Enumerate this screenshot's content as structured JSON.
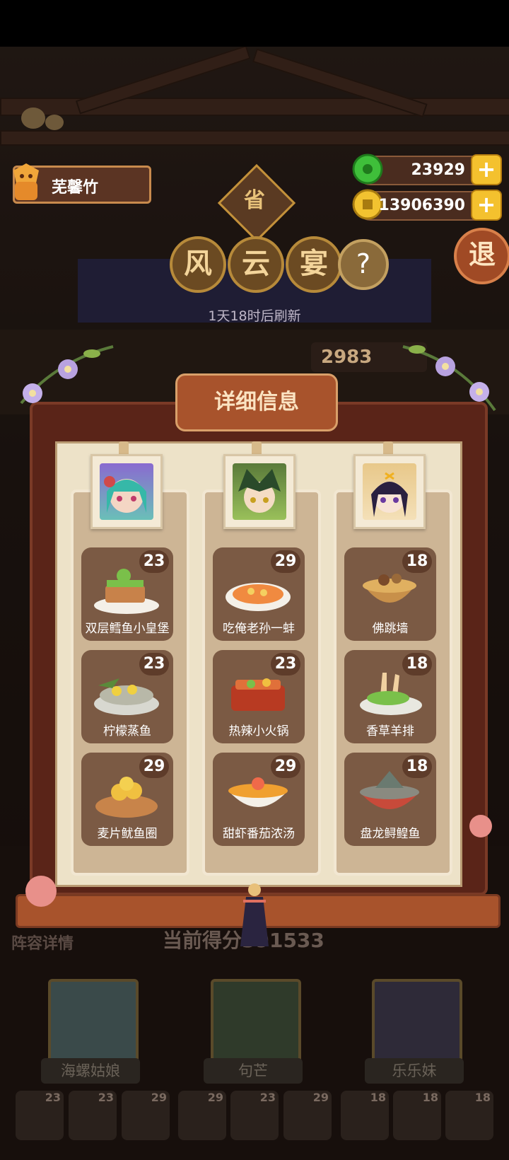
{
  "player": {
    "name": "芜馨竹"
  },
  "resources": [
    {
      "icon": "jade-coin-icon",
      "value": "23929"
    },
    {
      "icon": "gold-coin-icon",
      "value": "13906390"
    }
  ],
  "event": {
    "seal": "省",
    "title_chars": [
      "风",
      "云",
      "宴"
    ],
    "help": "?",
    "exit": "退",
    "refresh": "1天18时后刷新",
    "bg_score": "2983"
  },
  "modal": {
    "title": "详细信息",
    "columns": [
      {
        "chef_icon": "sea-snail-girl-portrait",
        "dishes": [
          {
            "name": "双层鳕鱼小皇堡",
            "level": "23"
          },
          {
            "name": "柠檬蒸鱼",
            "level": "23"
          },
          {
            "name": "麦片鱿鱼圈",
            "level": "29"
          }
        ]
      },
      {
        "chef_icon": "gou-mang-portrait",
        "dishes": [
          {
            "name": "吃俺老孙一蚌",
            "level": "29"
          },
          {
            "name": "热辣小火锅",
            "level": "23"
          },
          {
            "name": "甜虾番茄浓汤",
            "level": "29"
          }
        ]
      },
      {
        "chef_icon": "lele-mei-portrait",
        "dishes": [
          {
            "name": "佛跳墙",
            "level": "18"
          },
          {
            "name": "香草羊排",
            "level": "18"
          },
          {
            "name": "盘龙鲟鳇鱼",
            "level": "18"
          }
        ]
      }
    ]
  },
  "lineup": {
    "label": "阵容详情",
    "score_text": "当前得分391533",
    "chefs": [
      "海螺姑娘",
      "句芒",
      "乐乐妹"
    ],
    "slots": [
      "23",
      "23",
      "29",
      "29",
      "23",
      "29",
      "18",
      "18",
      "18"
    ]
  },
  "colors": {
    "frame": "#5a2418",
    "paper": "#ede2c8",
    "accent": "#a8532c",
    "card": "#7b5a44"
  }
}
